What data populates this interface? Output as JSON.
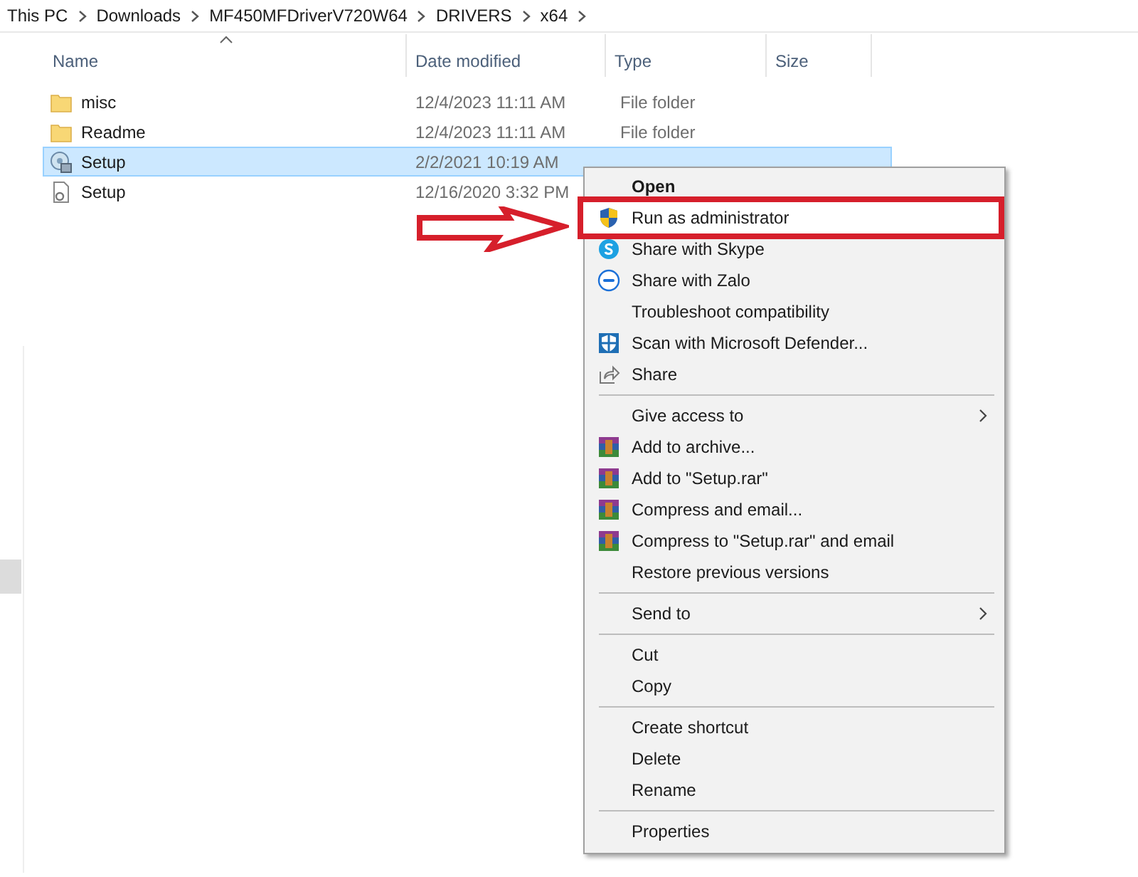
{
  "breadcrumb": [
    "This PC",
    "Downloads",
    "MF450MFDriverV720W64",
    "DRIVERS",
    "x64"
  ],
  "columns": [
    {
      "label": "Name",
      "sorted": true
    },
    {
      "label": "Date modified",
      "sorted": false
    },
    {
      "label": "Type",
      "sorted": false
    },
    {
      "label": "Size",
      "sorted": false
    }
  ],
  "files": [
    {
      "name": "misc",
      "kind": "folder",
      "date": "12/4/2023 11:11 AM",
      "type": "File folder",
      "selected": false
    },
    {
      "name": "Readme",
      "kind": "folder",
      "date": "12/4/2023 11:11 AM",
      "type": "File folder",
      "selected": false
    },
    {
      "name": "Setup",
      "kind": "application",
      "date": "2/2/2021 10:19 AM",
      "selected": true
    },
    {
      "name": "Setup",
      "kind": "config",
      "date": "12/16/2020 3:32 PM",
      "selected": false
    }
  ],
  "context_menu": [
    {
      "kind": "item",
      "label": "Open",
      "bold": true,
      "submenu": false,
      "highlighted": false
    },
    {
      "kind": "item",
      "label": "Run as administrator",
      "bold": false,
      "submenu": false,
      "highlighted": true
    },
    {
      "kind": "item",
      "label": "Share with Skype",
      "bold": false,
      "submenu": false,
      "highlighted": false
    },
    {
      "kind": "item",
      "label": "Share with Zalo",
      "bold": false,
      "submenu": false,
      "highlighted": false
    },
    {
      "kind": "item",
      "label": "Troubleshoot compatibility",
      "bold": false,
      "submenu": false,
      "highlighted": false
    },
    {
      "kind": "item",
      "label": "Scan with Microsoft Defender...",
      "bold": false,
      "submenu": false,
      "highlighted": false
    },
    {
      "kind": "item",
      "label": "Share",
      "bold": false,
      "submenu": false,
      "highlighted": false
    },
    {
      "kind": "separator"
    },
    {
      "kind": "item",
      "label": "Give access to",
      "bold": false,
      "submenu": true,
      "highlighted": false
    },
    {
      "kind": "item",
      "label": "Add to archive...",
      "bold": false,
      "submenu": false,
      "highlighted": false
    },
    {
      "kind": "item",
      "label": "Add to \"Setup.rar\"",
      "bold": false,
      "submenu": false,
      "highlighted": false
    },
    {
      "kind": "item",
      "label": "Compress and email...",
      "bold": false,
      "submenu": false,
      "highlighted": false
    },
    {
      "kind": "item",
      "label": "Compress to \"Setup.rar\" and email",
      "bold": false,
      "submenu": false,
      "highlighted": false
    },
    {
      "kind": "item",
      "label": "Restore previous versions",
      "bold": false,
      "submenu": false,
      "highlighted": false
    },
    {
      "kind": "separator"
    },
    {
      "kind": "item",
      "label": "Send to",
      "bold": false,
      "submenu": true,
      "highlighted": false
    },
    {
      "kind": "separator"
    },
    {
      "kind": "item",
      "label": "Cut",
      "bold": false,
      "submenu": false,
      "highlighted": false
    },
    {
      "kind": "item",
      "label": "Copy",
      "bold": false,
      "submenu": false,
      "highlighted": false
    },
    {
      "kind": "separator"
    },
    {
      "kind": "item",
      "label": "Create shortcut",
      "bold": false,
      "submenu": false,
      "highlighted": false
    },
    {
      "kind": "item",
      "label": "Delete",
      "bold": false,
      "submenu": false,
      "highlighted": false
    },
    {
      "kind": "item",
      "label": "Rename",
      "bold": false,
      "submenu": false,
      "highlighted": false
    },
    {
      "kind": "separator"
    },
    {
      "kind": "item",
      "label": "Properties",
      "bold": false,
      "submenu": false,
      "highlighted": false
    }
  ]
}
